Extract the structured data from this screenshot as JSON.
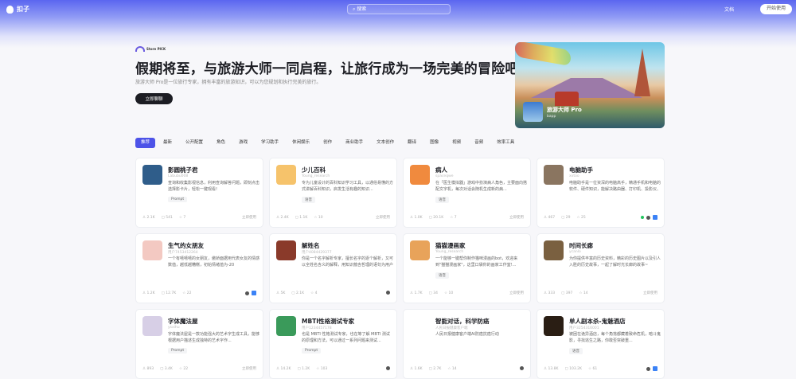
{
  "nav": {
    "logo": "扣子",
    "search_placeholder": "搜索",
    "docs": "文档",
    "start": "开始使用"
  },
  "hero": {
    "badge": "Store PICK",
    "title": "假期将至，与旅游大师一同启程，让旅行成为一场完美的冒险吧！",
    "subtitle": "旅游大师 Pro是一位旅行专家，拥有丰富的旅游知识，可以为您规划和执行完美的旅行。",
    "button": "立即聊聊",
    "card_name": "旅游大师 Pro",
    "card_author": "bapp"
  },
  "tabs": [
    "推荐",
    "最新",
    "公开配置",
    "角色",
    "游戏",
    "学习助手",
    "休闲娱乐",
    "创作",
    "商业助手",
    "文本创作",
    "翻译",
    "图像",
    "视频",
    "音频",
    "效率工具"
  ],
  "cards": [
    {
      "title": "影圆桃子君",
      "author": "Labubu008",
      "desc": "查询和收集影视信息，利用查询解答问题，即刻点击选择影卡片，轻松一键观看!",
      "tag": "Prompt",
      "stats": [
        "2.1K",
        "541",
        "7"
      ],
      "foot": "立即使用",
      "color": "#2f5d8a"
    },
    {
      "title": "少儿百科",
      "author": "Young_research",
      "desc": "专为儿童设计的百科知识学习工具，以通俗易懂的方式讲解百科知识，启发生活有趣的知识...",
      "tag": "语音",
      "stats": [
        "2.4K",
        "1.1K",
        "10"
      ],
      "foot": "立即使用",
      "color": "#f6c36b"
    },
    {
      "title": "病人",
      "author": "spaceqwe",
      "desc": "在「医生模拟器」游戏中扮演病人角色，主要面向搭配文字机，每次对话会随机生成新的病...",
      "tag": "语音",
      "stats": [
        "1.0K",
        "20.1K",
        "7"
      ],
      "foot": "立即使用",
      "color": "#f08a3e"
    },
    {
      "title": "电脑助手",
      "author": "xxtoo",
      "desc": "电脑助手是一位资深的电脑高手，精通手机和电脑的软件、硬件知识，能解决路由器、打印机、投影仪、Linux、iOS、网络、Docker、...",
      "tag": "",
      "stats": [
        "467",
        "29",
        "25"
      ],
      "foot": "",
      "color": "#8a7560"
    },
    {
      "title": "生气的女朋友",
      "author": "用户7453412264",
      "desc": "一个有嘻嘻嘻的女朋友，傲娇面据用代表女友的情感数值，越低越糟糕，初始情绪值为-20",
      "tag": "",
      "stats": [
        "1.2K",
        "12.7K",
        "22"
      ],
      "foot": "",
      "color": "#f3c9c2"
    },
    {
      "title": "解姓名",
      "author": "用户4084429377",
      "desc": "你是一个名字解析专家，擅长名字的逐个解析，又可以全姓名含义的解释，用知识蕴含哲理的语句为用户服务，指点人生，祝福和祝愿...",
      "tag": "",
      "stats": [
        "5K",
        "2.1K",
        "4"
      ],
      "foot": "",
      "color": "#8a3a2a"
    },
    {
      "title": "猫猫漫画家",
      "author": "Young_research",
      "desc": "一个能够一键帮你制作猫咪漫画的bot，欢迎来到\"猫猫漫画家\"，这里口袋你的画家工作室!...",
      "tag": "语音",
      "stats": [
        "1.7K",
        "34",
        "10"
      ],
      "foot": "立即使用",
      "color": "#e8a35a"
    },
    {
      "title": "时间长廊",
      "author": "ycanlo",
      "desc": "为你提供丰富的历史资料，精彩的历史图片以及引人入胜的历史故事，一起了解时光长廊的故事~",
      "tag": "",
      "stats": [
        "333",
        "397",
        "14"
      ],
      "foot": "立即使用",
      "color": "#7a6040"
    },
    {
      "title": "字体魔法屋",
      "author": "ysxihu",
      "desc": "字体魔法屋是一款功能强大的艺术字生成工具，能够根据用户描述生成独特的艺术字作...",
      "tag": "Prompt",
      "stats": [
        "893",
        "3.4K",
        "22"
      ],
      "foot": "立即使用",
      "color": "#d7cfe6"
    },
    {
      "title": "MBTI性格测试专家",
      "author": "用户1234457178",
      "desc": "也是 MBTI 性格测试专家，也在等了解 MBTI 测试的原理和方法，可以通过一系列问题来测试...",
      "tag": "Prompt",
      "stats": [
        "14.2K",
        "1.2K",
        "103"
      ],
      "foot": "",
      "color": "#3a9a5a"
    },
    {
      "title": "智能对话，科学防癌",
      "author": "人民日报健康客户端",
      "desc": "人民日报健康客户端AI防癌抗癌行动",
      "tag": "",
      "stats": [
        "1.6K",
        "2.7K",
        "14"
      ],
      "foot": "",
      "color": "#ffffff"
    },
    {
      "title": "单人剧本杀-鬼魅酒店",
      "author": "用户3254316001",
      "desc": "被困在诡异酒店，每个角落都藏着致命危机，暗斗鬼影，寻找逃生之路，你敢否突破重...",
      "tag": "语音",
      "stats": [
        "13.8K",
        "103.2K",
        "61"
      ],
      "foot": "",
      "color": "#2a1e14"
    }
  ]
}
